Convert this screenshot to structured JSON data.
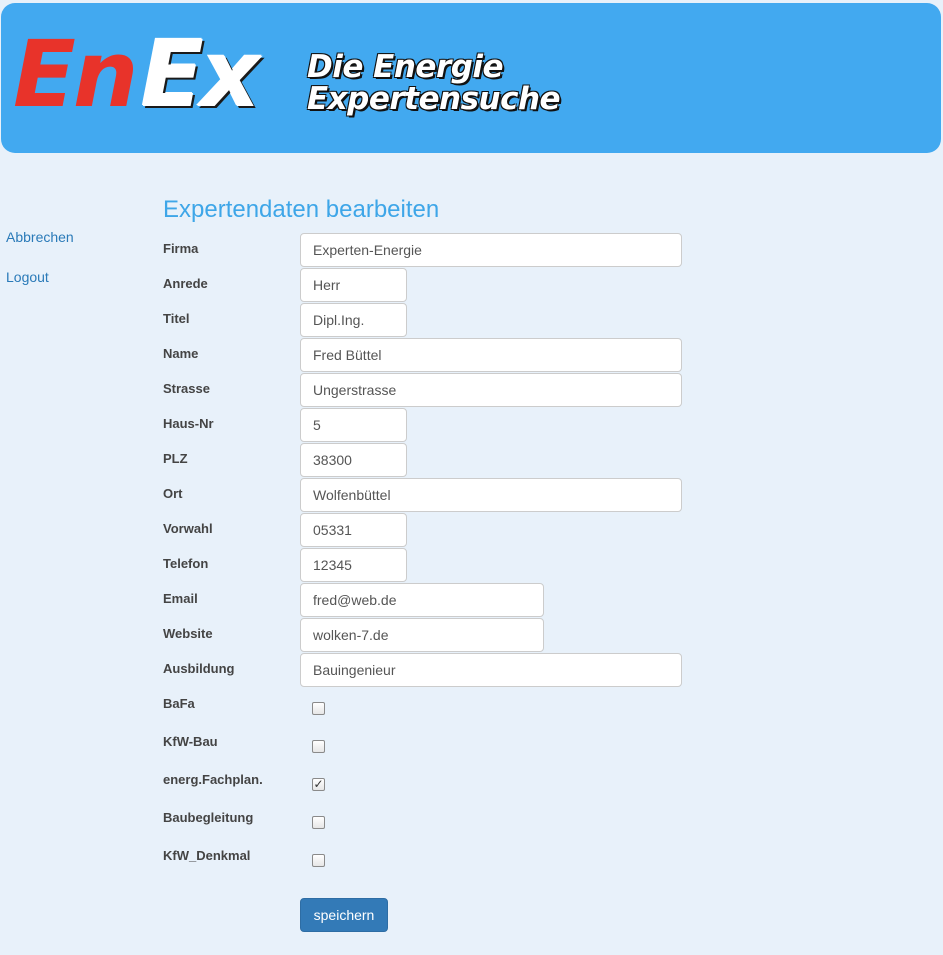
{
  "header": {
    "logo_en": "En",
    "logo_ex": "Ex",
    "slogan_line1": "Die Energie",
    "slogan_line2": "Expertensuche",
    "bg_color": "#42a9f0",
    "logo_red": "#e8332a"
  },
  "sidenav": {
    "cancel_label": "Abbrechen",
    "logout_label": "Logout"
  },
  "form": {
    "title": "Expertendaten bearbeiten",
    "firma": {
      "label": "Firma",
      "value": "Experten-Energie"
    },
    "anrede": {
      "label": "Anrede",
      "value": "Herr"
    },
    "titel": {
      "label": "Titel",
      "value": "Dipl.Ing."
    },
    "name": {
      "label": "Name",
      "value": "Fred Büttel"
    },
    "strasse": {
      "label": "Strasse",
      "value": "Ungerstrasse"
    },
    "hausnr": {
      "label": "Haus-Nr",
      "value": "5"
    },
    "plz": {
      "label": "PLZ",
      "value": "38300"
    },
    "ort": {
      "label": "Ort",
      "value": "Wolfenbüttel"
    },
    "vorwahl": {
      "label": "Vorwahl",
      "value": "05331"
    },
    "telefon": {
      "label": "Telefon",
      "value": "12345"
    },
    "email": {
      "label": "Email",
      "value": "fred@web.de"
    },
    "website": {
      "label": "Website",
      "value": "wolken-7.de"
    },
    "ausbildung": {
      "label": "Ausbildung",
      "value": "Bauingenieur"
    },
    "checkboxes": {
      "bafa": {
        "label": "BaFa",
        "checked": false
      },
      "kfw_bau": {
        "label": "KfW-Bau",
        "checked": false
      },
      "energ_fachplan": {
        "label": "energ.Fachplan.",
        "checked": true
      },
      "baubegleitung": {
        "label": "Baubegleitung",
        "checked": false
      },
      "kfw_denkmal": {
        "label": "KfW_Denkmal",
        "checked": false
      }
    },
    "save_label": "speichern"
  },
  "colors": {
    "page_bg": "#e8f1fa",
    "title_blue": "#3ea6e8",
    "link_blue": "#2a7ab8",
    "button_blue": "#337ab7"
  }
}
